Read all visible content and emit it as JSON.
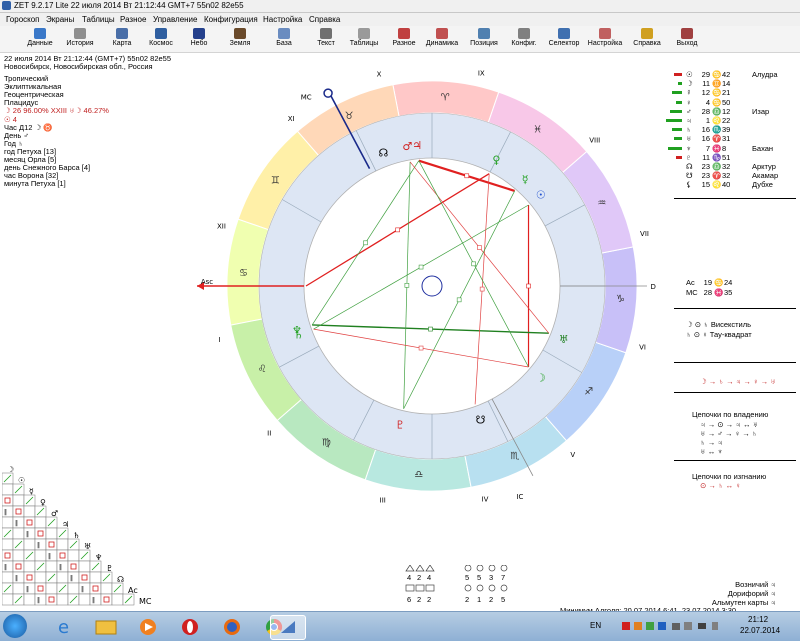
{
  "window": {
    "title": "ZET 9.2.17 Lite   22 июля 2014  Вт  21:12:44 GMT+7 55n02  82e55"
  },
  "menu": [
    "Гороскоп",
    "Экраны",
    "Таблицы",
    "Разное",
    "Управление",
    "Конфигурация",
    "Настройка",
    "Справка"
  ],
  "toolbar": [
    {
      "label": "Данные",
      "color": "#3a78c8"
    },
    {
      "label": "История",
      "color": "#8f8f8f"
    },
    {
      "label": "Карта",
      "color": "#4a6fa8"
    },
    {
      "label": "Космос",
      "color": "#2f5fa0"
    },
    {
      "label": "Небо",
      "color": "#24408c"
    },
    {
      "label": "Земля",
      "color": "#6a4a2a"
    },
    {
      "label": "База",
      "color": "#6a8cc0"
    },
    {
      "label": "Текст",
      "color": "#707070"
    },
    {
      "label": "Таблицы",
      "color": "#9a9a9a"
    },
    {
      "label": "Разное",
      "color": "#c04040"
    },
    {
      "label": "Динамика",
      "color": "#c05050"
    },
    {
      "label": "Позиция",
      "color": "#5080b0"
    },
    {
      "label": "Конфиг.",
      "color": "#808080"
    },
    {
      "label": "Селектор",
      "color": "#4070b0"
    },
    {
      "label": "Настройка",
      "color": "#c06060"
    },
    {
      "label": "Справка",
      "color": "#d0a020"
    },
    {
      "label": "Выход",
      "color": "#a04040"
    }
  ],
  "info": {
    "lines": [
      "22 июля 2014  Вт  21:12:44 (GMT+7) 55n02  82e55",
      "Новосибирск, Новосибирская обл., Россия",
      "Тропический",
      "Эклиптикальная",
      "Геоцентрическая",
      "Плацидус",
      "☽ 26 96.00% XXIII ♅☽ 46.27%",
      "☉  4",
      "Час Д12 ☽ ♉",
      "День ♂",
      "Год ♄",
      "год Петуха [13]",
      "месяц Орла [5]",
      "день Снежного Барса [4]",
      "час Ворона [32]",
      "минута Петуха [1]"
    ]
  },
  "chart": {
    "houses": [
      "I",
      "II",
      "III",
      "IV",
      "V",
      "VI",
      "VII",
      "VIII",
      "IX",
      "X",
      "XI",
      "XII"
    ],
    "angles": {
      "asc": "Asc",
      "dsc": "Dsc",
      "mc": "MC",
      "ic": "IC"
    },
    "signs": [
      "♈",
      "♉",
      "♊",
      "♋",
      "♌",
      "♍",
      "♎",
      "♏",
      "♐",
      "♑",
      "♒",
      "♓"
    ],
    "sign_colors": [
      "#ffc8c8",
      "#ffd8b8",
      "#fff0a8",
      "#f0ffb0",
      "#c8f0a8",
      "#b8e8c0",
      "#b8e8e0",
      "#b8e0f0",
      "#b8d0f8",
      "#c8c0f8",
      "#e0c8f8",
      "#f8c8e8"
    ],
    "planets": [
      {
        "glyph": "☽",
        "color": "#20a020"
      },
      {
        "glyph": "☉",
        "color": "#2050d0"
      },
      {
        "glyph": "☿",
        "color": "#20a020"
      },
      {
        "glyph": "♀",
        "color": "#20a020"
      },
      {
        "glyph": "♂",
        "color": "#d02020"
      },
      {
        "glyph": "♃",
        "color": "#d02020"
      },
      {
        "glyph": "♄",
        "color": "#20a020"
      },
      {
        "glyph": "♅",
        "color": "#208020"
      },
      {
        "glyph": "♆",
        "color": "#20a020"
      },
      {
        "glyph": "♇",
        "color": "#d02020"
      },
      {
        "glyph": "☊",
        "color": "#000000"
      },
      {
        "glyph": "☋",
        "color": "#000000"
      }
    ]
  },
  "positions": [
    {
      "glyph": "☉",
      "deg": "29",
      "sign": "♋",
      "min": "42",
      "note": "Алудра"
    },
    {
      "glyph": "☽",
      "deg": "11",
      "sign": "♊",
      "min": "14",
      "note": ""
    },
    {
      "glyph": "☿",
      "deg": "12",
      "sign": "♋",
      "min": "21",
      "note": ""
    },
    {
      "glyph": "♀",
      "deg": "4",
      "sign": "♋",
      "min": "50",
      "note": ""
    },
    {
      "glyph": "♂",
      "deg": "28",
      "sign": "♎",
      "min": "12",
      "note": "Изар"
    },
    {
      "glyph": "♃",
      "deg": "1",
      "sign": "♌",
      "min": "22",
      "note": ""
    },
    {
      "glyph": "♄",
      "deg": "16",
      "sign": "♏",
      "min": "39",
      "note": ""
    },
    {
      "glyph": "♅",
      "deg": "16",
      "sign": "♈",
      "min": "31",
      "note": ""
    },
    {
      "glyph": "♆",
      "deg": "7",
      "sign": "♓",
      "min": "8",
      "note": "Бахан"
    },
    {
      "glyph": "♇",
      "deg": "11",
      "sign": "♑",
      "min": "51",
      "note": ""
    },
    {
      "glyph": "☊",
      "deg": "23",
      "sign": "♎",
      "min": "32",
      "note": "Арктур"
    },
    {
      "glyph": "☋",
      "deg": "23",
      "sign": "♈",
      "min": "32",
      "note": "Акамар"
    },
    {
      "glyph": "⚸",
      "deg": "15",
      "sign": "♌",
      "min": "40",
      "note": "Дубхе"
    }
  ],
  "angles_panel": [
    {
      "label": "Ac",
      "deg": "19",
      "sign": "♋",
      "min": "24"
    },
    {
      "label": "MC",
      "deg": "28",
      "sign": "♓",
      "min": "35"
    }
  ],
  "configs": [
    {
      "text": "☽ ⊙ ♄  Висекстиль"
    },
    {
      "text": "♄ ⊙ ♀  Тау-квадрат"
    }
  ],
  "chain_line": "☽ → ♄ → ♃ → ♀ → ♅",
  "chains_own_title": "Цепочки по владению",
  "chains_own": [
    "♃ → ⊙ → ♃ ↔ ♅",
    "♅ → ♂ → ♀ → ♄",
    "♄ → ♃",
    "♅ ↔ ♆"
  ],
  "chains_exile_title": "Цепочки по изгнанию",
  "chains_exile": [
    "⊙ → ♄ ↔ ♀"
  ],
  "bottom_counts": {
    "left_top": [
      "4",
      "2",
      "4"
    ],
    "left_bottom": [
      "6",
      "2",
      "2"
    ],
    "mid_top": [
      "5",
      "5",
      "3",
      "7"
    ],
    "mid_bottom": [
      "2",
      "1",
      "2",
      "5"
    ]
  },
  "bottom_right": [
    "Возничий  ♃",
    "Дорифорий  ♃",
    "Альмутен карты  ♃",
    "Минимум Алголя: 20.07.2014  6:41,  23.07.2014  3:30"
  ],
  "grid_glyphs": [
    "☽",
    "☉",
    "☿",
    "♀",
    "♂",
    "♃",
    "♄",
    "♅",
    "♆",
    "♇",
    "☊",
    "Ac",
    "MC"
  ],
  "taskbar": {
    "lang": "EN",
    "time": "21:12",
    "date": "22.07.2014"
  }
}
